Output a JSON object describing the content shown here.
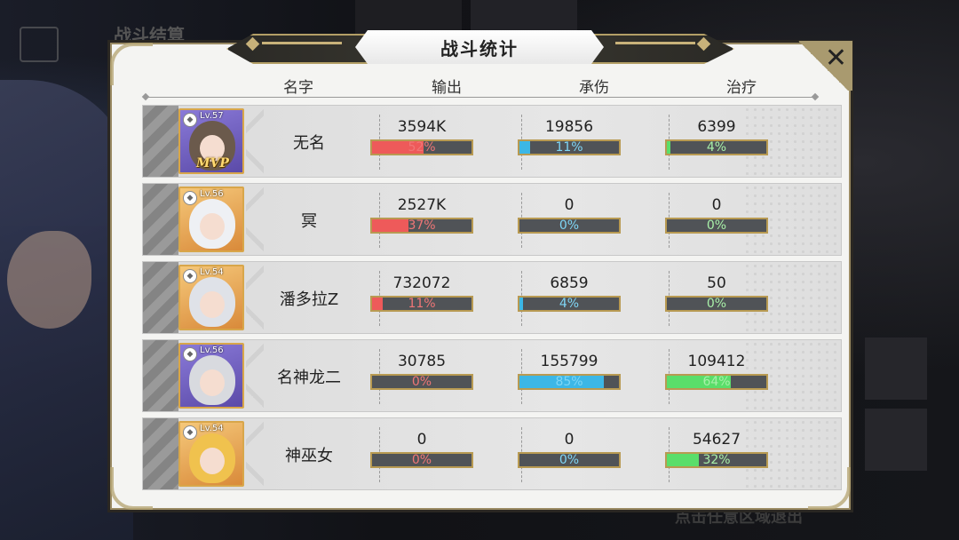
{
  "background": {
    "title": "战斗结算",
    "exit_hint": "点击任意区域退出"
  },
  "panel": {
    "title": "战斗统计",
    "close_icon": "close-icon",
    "columns": [
      "名字",
      "输出",
      "承伤",
      "治疗"
    ]
  },
  "rows": [
    {
      "name": "无名",
      "level": "Lv.57",
      "class_icon": "mage-icon",
      "mvp": "MVP",
      "damage": "3594K",
      "damage_pct": "52%",
      "damage_frac": 0.52,
      "taken": "19856",
      "taken_pct": "11%",
      "taken_frac": 0.11,
      "heal": "6399",
      "heal_pct": "4%",
      "heal_frac": 0.04
    },
    {
      "name": "冥",
      "level": "Lv.56",
      "class_icon": "assassin-icon",
      "mvp": "",
      "damage": "2527K",
      "damage_pct": "37%",
      "damage_frac": 0.37,
      "taken": "0",
      "taken_pct": "0%",
      "taken_frac": 0,
      "heal": "0",
      "heal_pct": "0%",
      "heal_frac": 0
    },
    {
      "name": "潘多拉Z",
      "level": "Lv.54",
      "class_icon": "assassin-icon",
      "mvp": "",
      "damage": "732072",
      "damage_pct": "11%",
      "damage_frac": 0.11,
      "taken": "6859",
      "taken_pct": "4%",
      "taken_frac": 0.04,
      "heal": "50",
      "heal_pct": "0%",
      "heal_frac": 0
    },
    {
      "name": "名神龙二",
      "level": "Lv.56",
      "class_icon": "tank-icon",
      "mvp": "",
      "damage": "30785",
      "damage_pct": "0%",
      "damage_frac": 0,
      "taken": "155799",
      "taken_pct": "85%",
      "taken_frac": 0.85,
      "heal": "109412",
      "heal_pct": "64%",
      "heal_frac": 0.64
    },
    {
      "name": "神巫女",
      "level": "Lv.54",
      "class_icon": "healer-icon",
      "mvp": "",
      "damage": "0",
      "damage_pct": "0%",
      "damage_frac": 0,
      "taken": "0",
      "taken_pct": "0%",
      "taken_frac": 0,
      "heal": "54627",
      "heal_pct": "32%",
      "heal_frac": 0.32
    }
  ],
  "colors": {
    "damage": "#ee5a5a",
    "taken": "#3cb7e6",
    "heal": "#5ade6a",
    "frame_gold": "#b89a52"
  }
}
